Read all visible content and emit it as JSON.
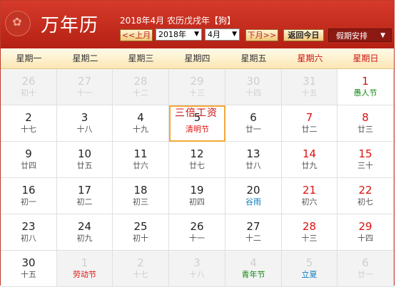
{
  "header": {
    "title": "万年历",
    "date_text": "2018年4月 农历戊戌年【狗】",
    "prev_label": "<<上月",
    "year_select": "2018年",
    "month_select": "4月",
    "next_label": "下月>>",
    "today_label": "返回今日",
    "holiday_label": "假期安排",
    "logo_icon": "lantern-icon"
  },
  "weekdays": [
    "星期一",
    "星期二",
    "星期三",
    "星期四",
    "星期五",
    "星期六",
    "星期日"
  ],
  "overlay_text": "三倍工资",
  "rows": [
    [
      {
        "day": "26",
        "lunar": "初十",
        "other": true
      },
      {
        "day": "27",
        "lunar": "十一",
        "other": true
      },
      {
        "day": "28",
        "lunar": "十二",
        "other": true
      },
      {
        "day": "29",
        "lunar": "十三",
        "other": true
      },
      {
        "day": "30",
        "lunar": "十四",
        "other": true
      },
      {
        "day": "31",
        "lunar": "十五",
        "other": true
      },
      {
        "day": "1",
        "lunar": "愚人节",
        "style": "festival-green"
      }
    ],
    [
      {
        "day": "2",
        "lunar": "十七"
      },
      {
        "day": "3",
        "lunar": "十八"
      },
      {
        "day": "4",
        "lunar": "十九"
      },
      {
        "day": "5",
        "lunar": "清明节",
        "style": "festival-red",
        "today": true
      },
      {
        "day": "6",
        "lunar": "廿一"
      },
      {
        "day": "7",
        "lunar": "廿二"
      },
      {
        "day": "8",
        "lunar": "廿三"
      }
    ],
    [
      {
        "day": "9",
        "lunar": "廿四"
      },
      {
        "day": "10",
        "lunar": "廿五"
      },
      {
        "day": "11",
        "lunar": "廿六"
      },
      {
        "day": "12",
        "lunar": "廿七"
      },
      {
        "day": "13",
        "lunar": "廿八"
      },
      {
        "day": "14",
        "lunar": "廿九"
      },
      {
        "day": "15",
        "lunar": "三十"
      }
    ],
    [
      {
        "day": "16",
        "lunar": "初一"
      },
      {
        "day": "17",
        "lunar": "初二"
      },
      {
        "day": "18",
        "lunar": "初三"
      },
      {
        "day": "19",
        "lunar": "初四"
      },
      {
        "day": "20",
        "lunar": "谷雨",
        "style": "term"
      },
      {
        "day": "21",
        "lunar": "初六"
      },
      {
        "day": "22",
        "lunar": "初七"
      }
    ],
    [
      {
        "day": "23",
        "lunar": "初八"
      },
      {
        "day": "24",
        "lunar": "初九"
      },
      {
        "day": "25",
        "lunar": "初十"
      },
      {
        "day": "26",
        "lunar": "十一"
      },
      {
        "day": "27",
        "lunar": "十二"
      },
      {
        "day": "28",
        "lunar": "十三"
      },
      {
        "day": "29",
        "lunar": "十四"
      }
    ],
    [
      {
        "day": "30",
        "lunar": "十五"
      },
      {
        "day": "1",
        "lunar": "劳动节",
        "other": true,
        "style": "festival-red"
      },
      {
        "day": "2",
        "lunar": "十七",
        "other": true
      },
      {
        "day": "3",
        "lunar": "十八",
        "other": true
      },
      {
        "day": "4",
        "lunar": "青年节",
        "other": true,
        "style": "festival-green"
      },
      {
        "day": "5",
        "lunar": "立夏",
        "other": true,
        "style": "term"
      },
      {
        "day": "6",
        "lunar": "廿一",
        "other": true
      }
    ]
  ]
}
